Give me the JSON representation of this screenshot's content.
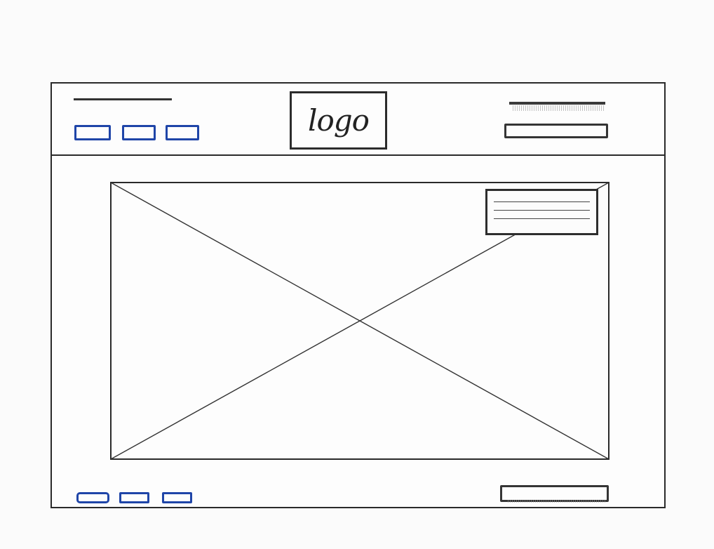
{
  "header": {
    "logo_text": "logo",
    "nav_buttons": [
      "",
      "",
      ""
    ],
    "search": {
      "value": "",
      "placeholder": ""
    }
  },
  "hero": {
    "caption_lines": 3
  },
  "footer": {
    "nav_buttons": [
      "",
      "",
      ""
    ],
    "input": {
      "value": "",
      "placeholder": ""
    }
  },
  "colors": {
    "stroke": "#2a2a2a",
    "nav_button_stroke": "#1f45a8",
    "paper": "#fbfbfb"
  }
}
